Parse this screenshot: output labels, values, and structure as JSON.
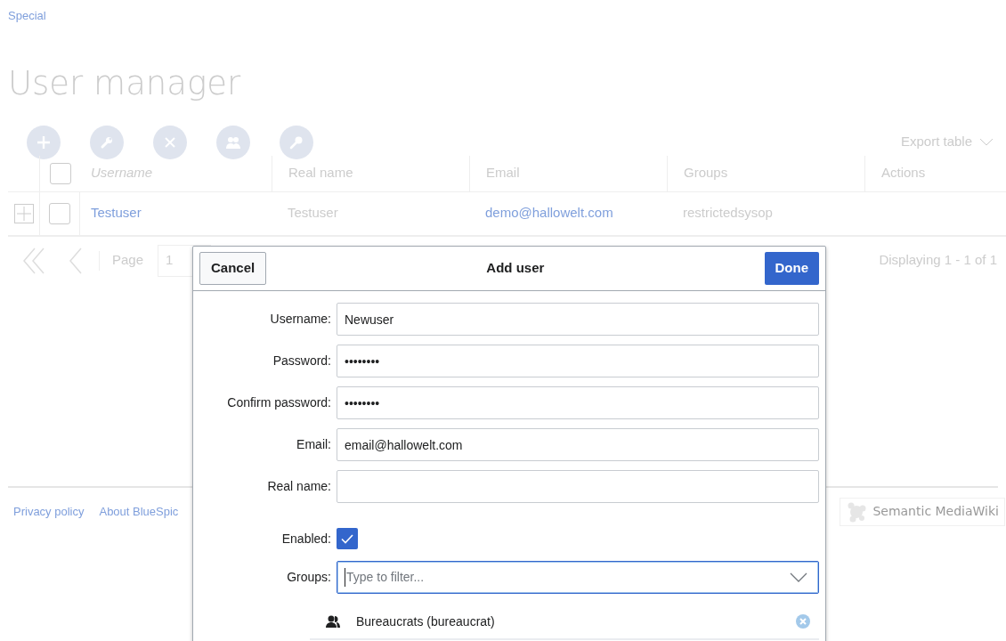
{
  "breadcrumb": "Special",
  "title": "User manager",
  "toolbar": [
    {
      "kind": "add"
    },
    {
      "kind": "edit"
    },
    {
      "kind": "delete"
    },
    {
      "kind": "groups"
    },
    {
      "kind": "password"
    }
  ],
  "export": {
    "label": "Export table"
  },
  "table": {
    "all_checked": false,
    "columns": [
      {
        "label": "Username",
        "sorted": true
      },
      {
        "label": "Real name",
        "sorted": false
      },
      {
        "label": "Email",
        "sorted": false
      },
      {
        "label": "Groups",
        "sorted": false
      },
      {
        "label": "Actions",
        "sorted": false
      }
    ],
    "rows": [
      {
        "checked": false,
        "expanded": false,
        "username": "Testuser",
        "real_name": "Testuser",
        "email": "demo@hallowelt.com",
        "groups": "restrictedsysop"
      }
    ]
  },
  "pager": {
    "page_label": "Page",
    "page": "1",
    "status": "Displaying 1 - 1 of 1"
  },
  "footer": {
    "links": [
      "Privacy policy",
      "About BlueSpic"
    ],
    "badge": "Semantic MediaWiki"
  },
  "dialog": {
    "title": "Add user",
    "cancel": "Cancel",
    "done": "Done",
    "fields": [
      {
        "kind": "text",
        "label": "Username:",
        "value": "Newuser"
      },
      {
        "kind": "text",
        "label": "Password:",
        "value": "••••••••"
      },
      {
        "kind": "text",
        "label": "Confirm password:",
        "value": "••••••••"
      },
      {
        "kind": "text",
        "label": "Email:",
        "value": "email@hallowelt.com"
      },
      {
        "kind": "text",
        "label": "Real name:"
      },
      {
        "kind": "checkbox",
        "label": "Enabled:",
        "checked": true
      },
      {
        "kind": "combo",
        "label": "Groups:",
        "placeholder": "Type to filter..."
      }
    ],
    "groups": [
      "Bureaucrats (bureaucrat)"
    ]
  }
}
